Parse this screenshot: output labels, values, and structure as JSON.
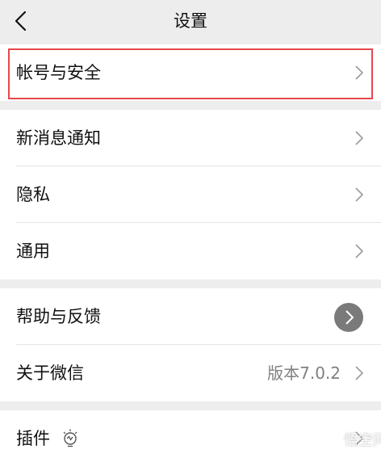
{
  "nav": {
    "title": "设置",
    "back_icon": "chevron-left-icon"
  },
  "groups": [
    {
      "items": [
        {
          "label": "帐号与安全",
          "highlighted": true,
          "icon": "chevron-right-icon"
        }
      ]
    },
    {
      "items": [
        {
          "label": "新消息通知",
          "icon": "chevron-right-icon"
        },
        {
          "label": "隐私",
          "icon": "chevron-right-icon"
        },
        {
          "label": "通用",
          "icon": "chevron-right-icon"
        }
      ]
    },
    {
      "items": [
        {
          "label": "帮助与反馈",
          "icon": "chevron-right-icon"
        },
        {
          "label": "关于微信",
          "value": "版本7.0.2",
          "icon": "chevron-right-icon"
        }
      ]
    },
    {
      "items": [
        {
          "label": "插件",
          "icon": "chevron-right-icon",
          "extra_icon": "plugin-bulb-icon"
        }
      ]
    }
  ],
  "watermark": {
    "text": "悟空问答"
  },
  "colors": {
    "background": "#ededed",
    "cell": "#ffffff",
    "highlight_border": "#e5484d",
    "secondary_text": "#808080"
  }
}
